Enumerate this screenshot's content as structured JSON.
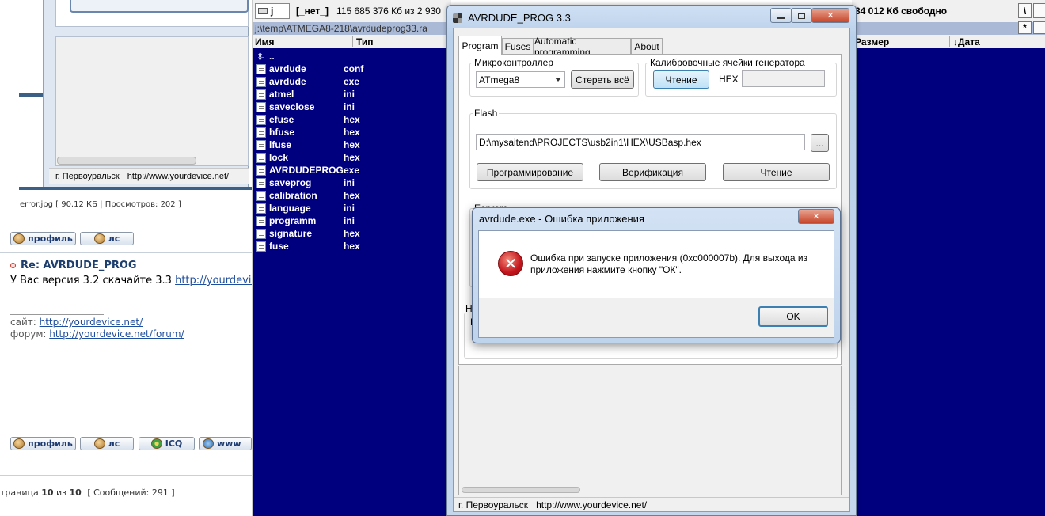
{
  "forum": {
    "city_text": "г. Первоуральск",
    "city_url": "http://www.yourdevice.net/",
    "attachment": "error.jpg [ 90.12 КБ | Просмотров: 202 ]",
    "profile_label": "профиль",
    "pm_label": "лс",
    "post_title": "Re: AVRDUDE_PROG",
    "post_text": "У Вас версия 3.2 скачайте 3.3",
    "post_link": "http://yourdevic",
    "sig_site_label": "сайт:",
    "sig_site_url": "http://yourdevice.net/",
    "sig_forum_label": "форум:",
    "sig_forum_url": "http://yourdevice.net/forum/",
    "icq_label": "ICQ",
    "www_label": "www",
    "page_prefix": "траница",
    "page_current": "10",
    "page_of": "из",
    "page_total": "10",
    "messages": "[ Сообщений: 291 ]"
  },
  "file_manager": {
    "drive": "j",
    "volume_label": "[_нет_]",
    "space_info": "115 685 376 Кб из 2 930",
    "path": "j:\\temp\\ATMEGA8-218\\avrdudeprog33.ra",
    "col_name": "Имя",
    "col_type": "Тип",
    "files": [
      {
        "name": "..",
        "ext": ""
      },
      {
        "name": "avrdude",
        "ext": "conf"
      },
      {
        "name": "avrdude",
        "ext": "exe"
      },
      {
        "name": "atmel",
        "ext": "ini"
      },
      {
        "name": "saveclose",
        "ext": "ini"
      },
      {
        "name": "efuse",
        "ext": "hex"
      },
      {
        "name": "hfuse",
        "ext": "hex"
      },
      {
        "name": "lfuse",
        "ext": "hex"
      },
      {
        "name": "lock",
        "ext": "hex"
      },
      {
        "name": "AVRDUDEPROG",
        "ext": "exe"
      },
      {
        "name": "saveprog",
        "ext": "ini"
      },
      {
        "name": "calibration",
        "ext": "hex"
      },
      {
        "name": "language",
        "ext": "ini"
      },
      {
        "name": "programm",
        "ext": "ini"
      },
      {
        "name": "signature",
        "ext": "hex"
      },
      {
        "name": "fuse",
        "ext": "hex"
      }
    ]
  },
  "right_panel": {
    "free_space": "34 012 Кб свободно",
    "col_size": "Размер",
    "col_date": "Дата",
    "backslash_btn": "\\",
    "star_btn": "*"
  },
  "avrdude": {
    "title": "AVRDUDE_PROG 3.3",
    "tabs": [
      "Program",
      "Fuses",
      "Automatic programming",
      "About"
    ],
    "mcu_label": "Микроконтроллер",
    "mcu_value": "ATmega8",
    "erase_label": "Стереть всё",
    "calib_label": "Калибровочные ячейки генератора",
    "calib_read": "Чтение",
    "hex_label": "HEX",
    "flash_label": "Flash",
    "flash_path": "D:\\mysaitend\\PROJECTS\\usb2in1\\HEX\\USBasp.hex",
    "browse": "...",
    "program_btn": "Программирование",
    "verify_btn": "Верификация",
    "read_btn": "Чтение",
    "eeprom_label": "Eeprom",
    "partial_label": "На",
    "partial_letter": "П",
    "status_city": "г. Первоуральск",
    "status_url": "http://www.yourdevice.net/"
  },
  "dialog": {
    "title": "avrdude.exe - Ошибка приложения",
    "message_line1": "Ошибка при запуске приложения (0xc000007b). Для выхода из",
    "message_line2": "приложения нажмите кнопку \"ОК\".",
    "ok_label": "OK"
  }
}
